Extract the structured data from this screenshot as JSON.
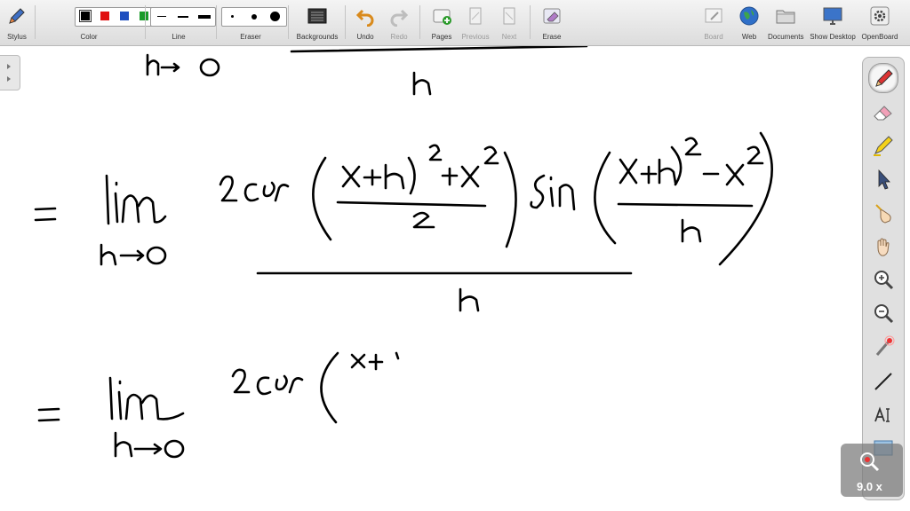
{
  "toolbar": {
    "stylus": "Stylus",
    "color": "Color",
    "line": "Line",
    "eraser": "Eraser",
    "backgrounds": "Backgrounds",
    "undo": "Undo",
    "redo": "Redo",
    "pages": "Pages",
    "previous": "Previous",
    "next": "Next",
    "erase": "Erase",
    "board": "Board",
    "web": "Web",
    "documents": "Documents",
    "show_desktop": "Show Desktop",
    "openboard": "OpenBoard"
  },
  "colors": [
    "#000000",
    "#e01010",
    "#1f4fbf",
    "#1a9a2a",
    "#f2e600"
  ],
  "selected_color": "#000000",
  "palette_tools": [
    "pen-icon",
    "eraser-tool-icon",
    "highlighter-icon",
    "selector-arrow-icon",
    "interactor-hand-icon",
    "hand-pan-icon",
    "zoom-in-icon",
    "zoom-out-icon",
    "laser-pointer-icon",
    "line-tool-icon",
    "text-tool-icon",
    "capture-icon"
  ],
  "zoom": {
    "label": "9.0 x"
  }
}
